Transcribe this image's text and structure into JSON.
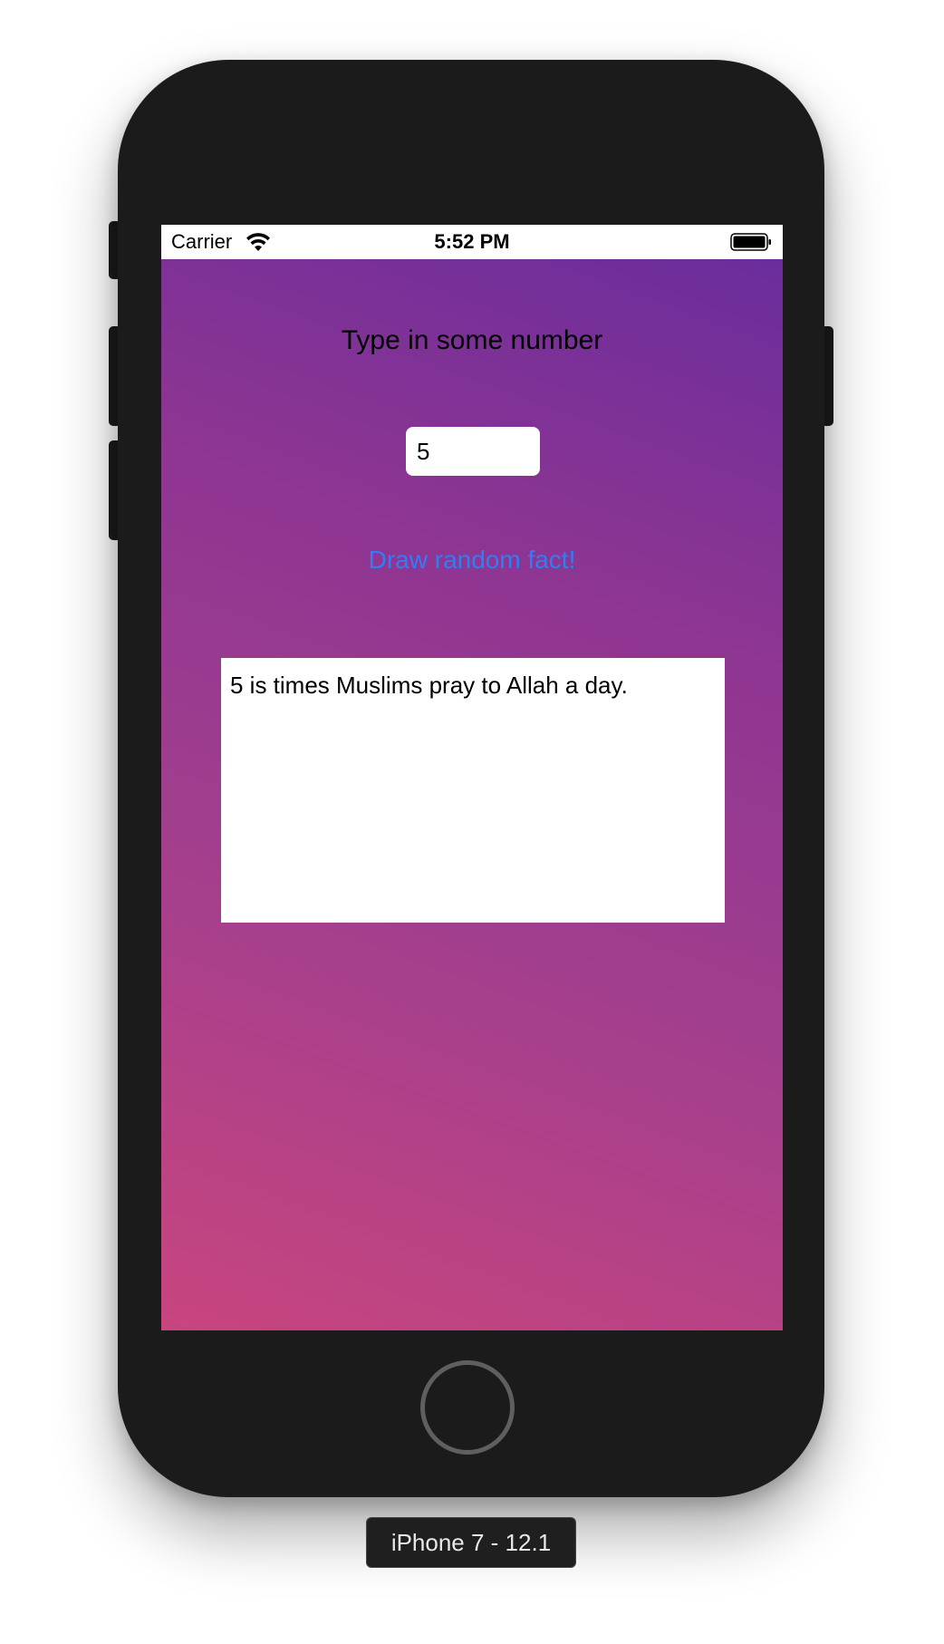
{
  "device": {
    "label": "iPhone 7 - 12.1"
  },
  "status_bar": {
    "carrier": "Carrier",
    "time": "5:52 PM",
    "wifi_icon": "wifi-icon",
    "battery_icon": "battery-icon"
  },
  "app": {
    "prompt_label": "Type in some number",
    "number_input": {
      "value": "5",
      "placeholder": ""
    },
    "draw_button_label": "Draw random fact!",
    "fact_text": "5 is times Muslims pray to Allah a day."
  },
  "colors": {
    "gradient_top_right": "#6b2d9c",
    "gradient_bottom_left": "#c8457f",
    "button_text": "#2f7ef6",
    "phone_body": "#1b1b1b"
  }
}
